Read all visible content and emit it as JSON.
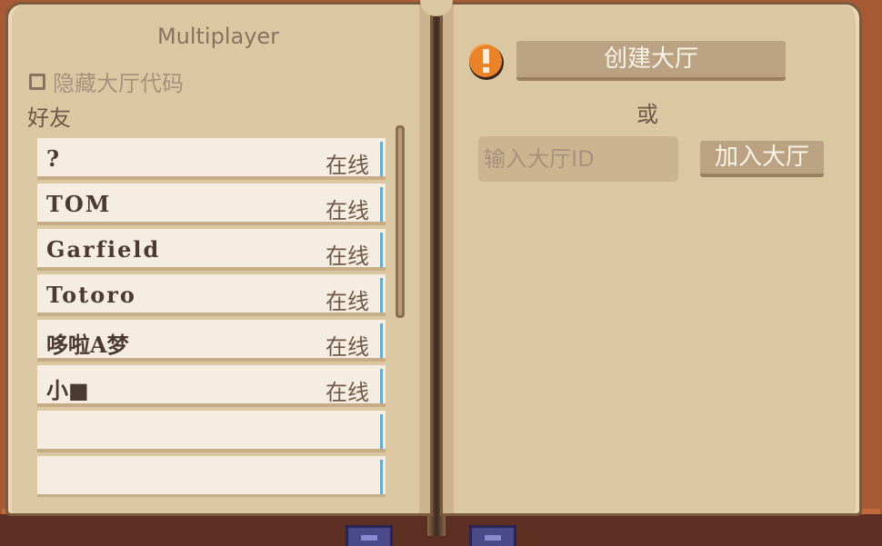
{
  "left_page": {
    "title": "Multiplayer",
    "hide_code_label": "隐藏大厅代码",
    "friends_label": "好友",
    "friends": [
      {
        "name": "?",
        "status": "在线"
      },
      {
        "name": "TOM",
        "status": "在线"
      },
      {
        "name": "Garfield",
        "status": "在线"
      },
      {
        "name": "Totoro",
        "status": "在线"
      },
      {
        "name": "哆啦A梦",
        "status": "在线"
      },
      {
        "name": "小■",
        "status": "在线"
      },
      {
        "name": "",
        "status": ""
      },
      {
        "name": "",
        "status": ""
      }
    ]
  },
  "right_page": {
    "create_button": "创建大厅",
    "or_label": "或",
    "lobby_input_placeholder": "输入大厅ID",
    "join_button": "加入大厅"
  },
  "icons": {
    "info": "info-icon"
  },
  "colors": {
    "page": "#dcc7a3",
    "cover": "#a85a35",
    "button": "#bba283",
    "online_accent": "#6aa9c9",
    "info_icon": "#e8832a"
  }
}
